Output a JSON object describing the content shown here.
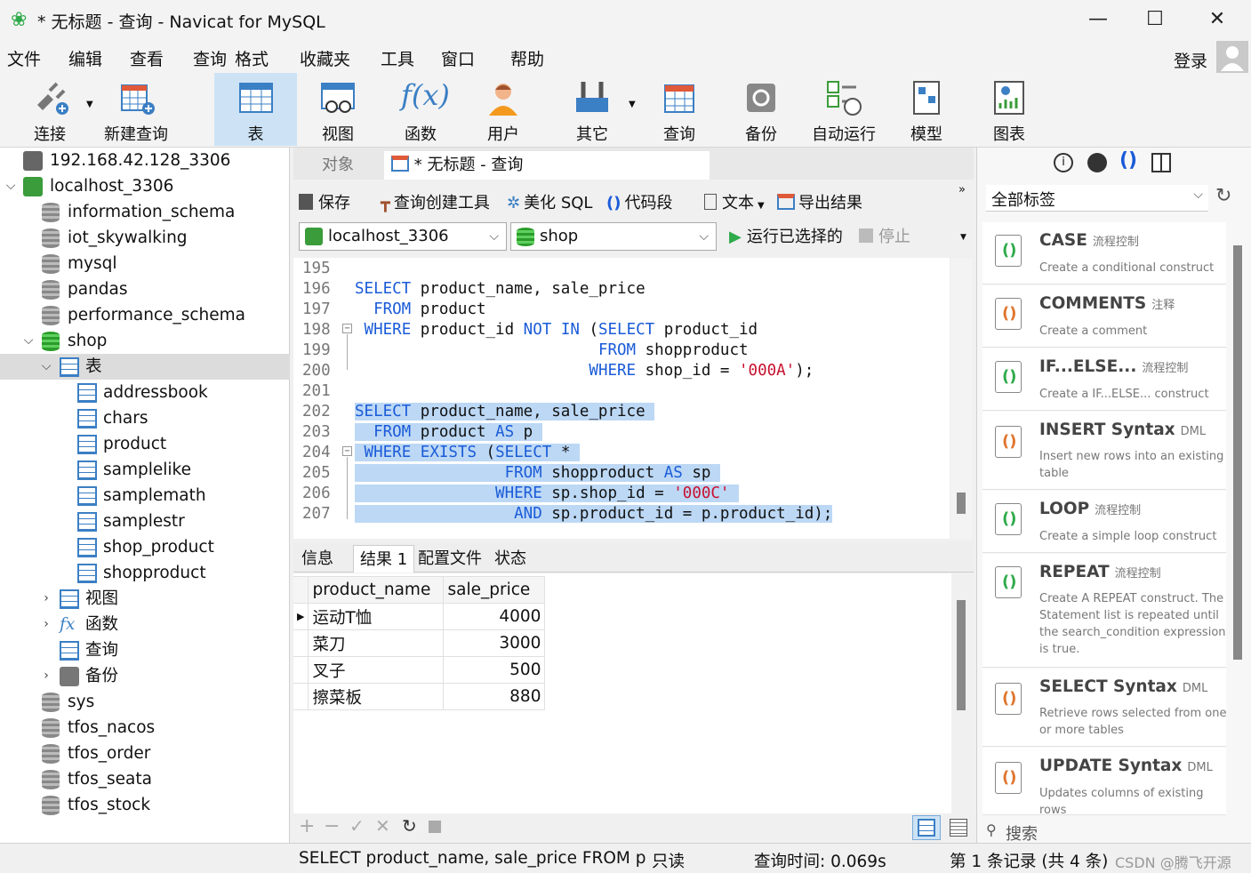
{
  "window": {
    "title": "* 无标题 - 查询 - Navicat for MySQL",
    "minimize": "—",
    "maximize": "☐",
    "close": "✕"
  },
  "menu": [
    "文件",
    "编辑",
    "查看",
    "查询",
    "格式",
    "收藏夹",
    "工具",
    "窗口",
    "帮助"
  ],
  "login": "登录",
  "toolbar": [
    "连接",
    "新建查询",
    "表",
    "视图",
    "函数",
    "用户",
    "其它",
    "查询",
    "备份",
    "自动运行",
    "模型",
    "图表"
  ],
  "tree": {
    "conn1": "192.168.42.128_3306",
    "conn2": "localhost_3306",
    "dbs_before": [
      "information_schema",
      "iot_skywalking",
      "mysql",
      "pandas",
      "performance_schema"
    ],
    "shop": "shop",
    "tables_node": "表",
    "tables": [
      "addressbook",
      "chars",
      "product",
      "samplelike",
      "samplemath",
      "samplestr",
      "shop_product",
      "shopproduct"
    ],
    "view_node": "视图",
    "func_node": "函数",
    "query_node": "查询",
    "backup_node": "备份",
    "dbs_after": [
      "sys",
      "tfos_nacos",
      "tfos_order",
      "tfos_seata",
      "tfos_stock"
    ]
  },
  "tabs": {
    "objects": "对象",
    "query": "* 无标题 - 查询"
  },
  "editor_toolbar": {
    "save": "保存",
    "builder": "查询创建工具",
    "beautify": "美化 SQL",
    "snippet": "代码段",
    "text": "文本",
    "export": "导出结果"
  },
  "selectors": {
    "connection": "localhost_3306",
    "database": "shop",
    "run": "运行已选择的",
    "stop": "停止"
  },
  "code": {
    "line_numbers": [
      "195",
      "196",
      "197",
      "198",
      "199",
      "200",
      "201",
      "202",
      "203",
      "204",
      "205",
      "206",
      "207"
    ],
    "kw_select": "SELECT",
    "kw_from": "FROM",
    "kw_where": "WHERE",
    "kw_not": "NOT",
    "kw_in": "IN",
    "kw_exists": "EXISTS",
    "kw_as": "AS",
    "kw_and": "AND",
    "t196": " product_name, sale_price",
    "t197": " product",
    "t198a": " product_id ",
    "t198b": " (",
    "t198c": " product_id",
    "t199": " shopproduct",
    "t200a": " shop_id = ",
    "t200s": "'000A'",
    "t200b": ");",
    "t202": " product_name, sale_price ",
    "t203a": " product ",
    "t203b": " p ",
    "t204a": " ",
    "t204b": " (",
    "t204c": " * ",
    "t205a": " shopproduct ",
    "t205b": " sp ",
    "t206a": " sp.shop_id = ",
    "t206s": "'000C'",
    "t206b": " ",
    "t207": " sp.product_id = p.product_id);"
  },
  "result_tabs": [
    "信息",
    "结果 1",
    "配置文件",
    "状态"
  ],
  "grid": {
    "columns": [
      "product_name",
      "sale_price"
    ],
    "rows": [
      [
        "运动T恤",
        "4000"
      ],
      [
        "菜刀",
        "3000"
      ],
      [
        "叉子",
        "500"
      ],
      [
        "擦菜板",
        "880"
      ]
    ]
  },
  "status": {
    "sql": "SELECT product_name, sale_price   FROM pro",
    "mode": "只读",
    "time": "查询时间: 0.069s",
    "records": "第 1 条记录 (共 4 条)",
    "watermark": "CSDN @腾飞开源"
  },
  "right_panel": {
    "filter": "全部标签",
    "search_placeholder": "搜索",
    "snippets": [
      {
        "title": "CASE",
        "tag": "流程控制",
        "desc": "Create a conditional construct"
      },
      {
        "title": "COMMENTS",
        "tag": "注释",
        "desc": "Create a comment"
      },
      {
        "title": "IF...ELSE...",
        "tag": "流程控制",
        "desc": "Create a IF...ELSE... construct"
      },
      {
        "title": "INSERT Syntax",
        "tag": "DML",
        "desc": "Insert new rows into an existing table"
      },
      {
        "title": "LOOP",
        "tag": "流程控制",
        "desc": "Create a simple loop construct"
      },
      {
        "title": "REPEAT",
        "tag": "流程控制",
        "desc": "Create A REPEAT construct. The Statement list is repeated until the search_condition expression is true."
      },
      {
        "title": "SELECT Syntax",
        "tag": "DML",
        "desc": "Retrieve rows selected from one or more tables"
      },
      {
        "title": "UPDATE Syntax",
        "tag": "DML",
        "desc": "Updates columns of existing rows"
      }
    ]
  }
}
